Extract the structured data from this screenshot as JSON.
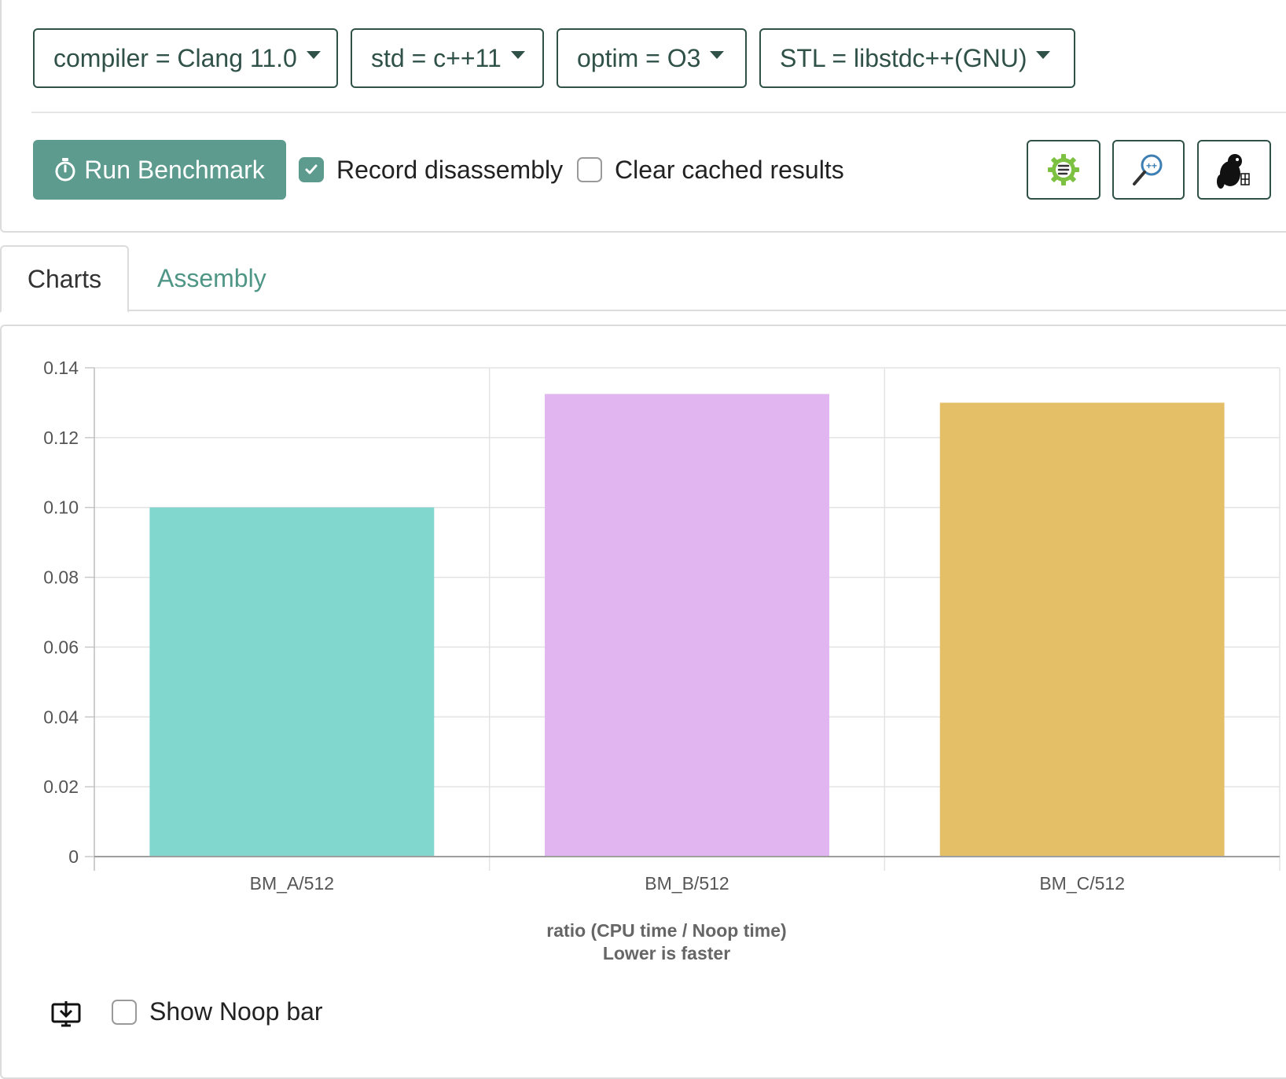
{
  "filters": [
    {
      "label": "compiler = Clang 11.0"
    },
    {
      "label": "std = c++11"
    },
    {
      "label": "optim = O3"
    },
    {
      "label": "STL = libstdc++(GNU)"
    }
  ],
  "toolbar": {
    "run_label": "Run Benchmark",
    "record_disassembly": {
      "label": "Record disassembly",
      "checked": true
    },
    "clear_cached": {
      "label": "Clear cached results",
      "checked": false
    },
    "icons": [
      "settings-gear-icon",
      "zoom-cpp-icon",
      "beaver-icon"
    ]
  },
  "tabs": [
    {
      "label": "Charts",
      "active": true
    },
    {
      "label": "Assembly",
      "active": false
    }
  ],
  "chart_data": {
    "type": "bar",
    "categories": [
      "BM_A/512",
      "BM_B/512",
      "BM_C/512"
    ],
    "values": [
      0.1,
      0.1325,
      0.13
    ],
    "colors": [
      "#81d6cd",
      "#e1b6f0",
      "#e5bf68"
    ],
    "xlabel": [
      "ratio (CPU time / Noop time)",
      "Lower is faster"
    ],
    "ylabel": "",
    "ylim": [
      0,
      0.14
    ],
    "yticks": [
      "0",
      "0.02",
      "0.04",
      "0.06",
      "0.08",
      "0.10",
      "0.12",
      "0.14"
    ],
    "grid": true
  },
  "footer": {
    "show_noop": {
      "label": "Show Noop bar",
      "checked": false
    },
    "download_icon": "download-icon"
  }
}
